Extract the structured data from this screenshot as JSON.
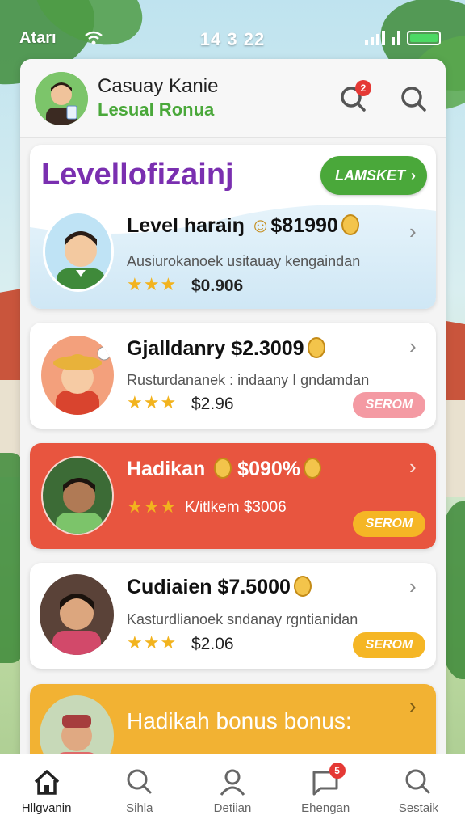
{
  "status_bar": {
    "carrier": "Atarı",
    "time": "14 3 22"
  },
  "header": {
    "title": "Casuay Kanie",
    "subtitle": "Lesual Ronua",
    "notification_count": "2"
  },
  "promo": {
    "heading": "Levellofizainj",
    "button_label": "LAMSKET"
  },
  "cards": [
    {
      "name": "Level haraiŋ",
      "amount": "$81990",
      "description": "Ausiurokanoek usitauay kengaindan",
      "rating": "★★★",
      "price": "$0.906"
    },
    {
      "name": "Gjalldanry",
      "amount": "$2.3009",
      "description": "Rusturdananek : indaany I gndamdan",
      "rating": "★★★",
      "price": "$2.96",
      "action_label": "SEROM"
    },
    {
      "name": "Hadikan",
      "amount": "$090%",
      "rating": "★★★",
      "price": "K/itlkem $3006",
      "action_label": "SEROM"
    },
    {
      "name": "Cudiaien",
      "amount": "$7.5000",
      "description": "Kasturdlianoek sndanay rgntianidan",
      "rating": "★★★",
      "price": "$2.06",
      "action_label": "SEROM"
    },
    {
      "name": "Hadikah bonus bonus:"
    }
  ],
  "nav": {
    "items": [
      {
        "label": "Hllgvanin",
        "icon": "home-icon"
      },
      {
        "label": "Sihla",
        "icon": "search-icon"
      },
      {
        "label": "Detiian",
        "icon": "user-icon"
      },
      {
        "label": "Ehengan",
        "icon": "chat-icon",
        "badge": "5"
      },
      {
        "label": "Sestaik",
        "icon": "search-icon"
      }
    ]
  },
  "colors": {
    "accent_green": "#4aa83a",
    "purple": "#7a2fb0",
    "hot_card": "#e8553f",
    "gold_card": "#f2b233",
    "pink_pill": "#f49aa3",
    "gold_pill": "#f5b625"
  }
}
